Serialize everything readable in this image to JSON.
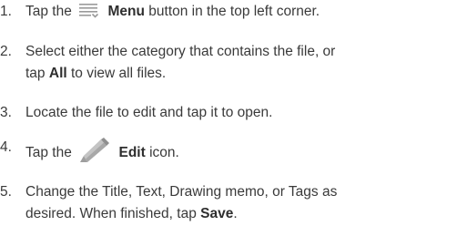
{
  "steps": [
    {
      "number": "1.",
      "pre": "Tap the",
      "icon": "menu-icon",
      "bold": "Menu",
      "post": "button in the top left corner."
    },
    {
      "number": "2.",
      "line1": "Select either the category that contains the file, or",
      "line2_pre": "tap",
      "bold": "All",
      "line2_post": "to view all files."
    },
    {
      "number": "3.",
      "text": "Locate the file to edit and tap it to open."
    },
    {
      "number": "4.",
      "pre": "Tap the",
      "icon": "pencil-edit-icon",
      "bold": "Edit",
      "post": "icon."
    },
    {
      "number": "5.",
      "line1": "Change the Title, Text, Drawing memo, or Tags as",
      "line2_pre": "desired. When finished, tap",
      "bold": "Save",
      "line2_post": "."
    }
  ],
  "colors": {
    "text": "#3a3a3a",
    "icon_gray": "#9a9a9a",
    "icon_gray_light": "#c9c9c9"
  }
}
